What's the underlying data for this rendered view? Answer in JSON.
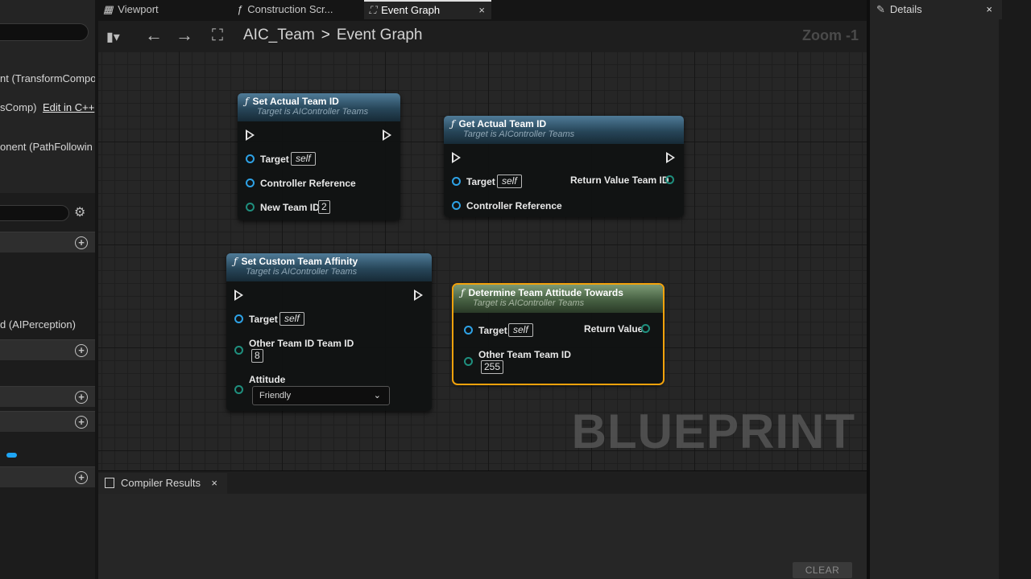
{
  "tabs": [
    {
      "icon": "",
      "label": "Viewport"
    },
    {
      "icon": "ƒ",
      "label": "Construction Scr..."
    },
    {
      "icon": "",
      "label": "Event Graph",
      "close": "×"
    }
  ],
  "header": {
    "breadcrumb_root": "AIC_Team",
    "breadcrumb_sep": ">",
    "breadcrumb_leaf": "Event Graph",
    "zoom": "Zoom -1"
  },
  "left_panel": {
    "components": [
      "nt (TransformCompo",
      "sComp)",
      "onent (PathFollowin"
    ],
    "edit_link": "Edit in C++",
    "perception": "d (AIPerception)"
  },
  "nodes": {
    "set_actual": {
      "title": "Set Actual Team ID",
      "subtitle": "Target is AIController Teams",
      "pins": {
        "target": "Target",
        "target_value": "self",
        "controller": "Controller Reference",
        "new_team": "New Team ID",
        "new_team_value": "2"
      }
    },
    "get_actual": {
      "title": "Get Actual Team ID",
      "subtitle": "Target is AIController Teams",
      "pins": {
        "target": "Target",
        "target_value": "self",
        "controller": "Controller Reference",
        "return": "Return Value Team ID"
      }
    },
    "set_affinity": {
      "title": "Set Custom Team Affinity",
      "subtitle": "Target is AIController Teams",
      "pins": {
        "target": "Target",
        "target_value": "self",
        "other": "Other Team ID Team ID",
        "other_value": "8",
        "attitude": "Attitude",
        "attitude_value": "Friendly"
      }
    },
    "determine": {
      "title": "Determine Team Attitude Towards",
      "subtitle": "Target is AIController Teams",
      "pins": {
        "target": "Target",
        "target_value": "self",
        "return": "Return Value",
        "other": "Other Team Team ID",
        "other_value": "255"
      }
    }
  },
  "watermark": "BLUEPRINT",
  "compiler": {
    "tab_label": "Compiler Results",
    "close": "×",
    "clear": "CLEAR"
  },
  "details": {
    "tab_label": "Details",
    "close": "×"
  },
  "colors": {
    "accent_selected": "#f2a20c",
    "pin_blue": "#2ea2e6",
    "pin_teal": "#1f8f7e"
  }
}
